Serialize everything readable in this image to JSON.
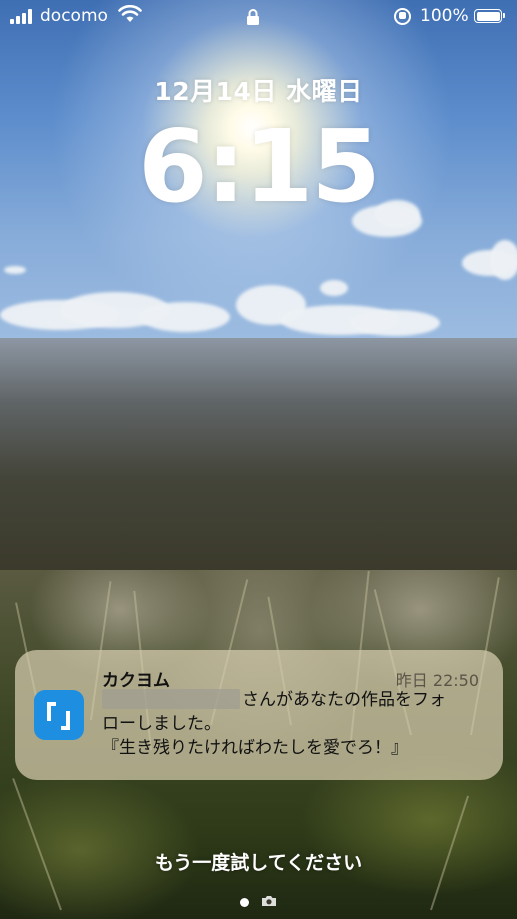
{
  "status_bar": {
    "carrier": "docomo",
    "battery_percent": "100%",
    "icons": [
      "signal-icon",
      "wifi-icon",
      "lock-icon",
      "orientation-lock-icon",
      "battery-icon"
    ]
  },
  "lock_screen": {
    "date": "12月14日 水曜日",
    "time": "6:15",
    "retry_message": "もう一度試してください"
  },
  "notification": {
    "app_name": "カクヨム",
    "timestamp": "昨日 22:50",
    "body_line1": "さんがあなたの作品をフォ",
    "body_line2": "ローしました。",
    "body_line3": "『生き残りたければわたしを愛でろ！』",
    "icon": "kakuyomu-app-icon",
    "icon_color": "#1E8FE0"
  },
  "page_indicator": {
    "icons": [
      "page-dot-icon",
      "camera-icon"
    ]
  }
}
